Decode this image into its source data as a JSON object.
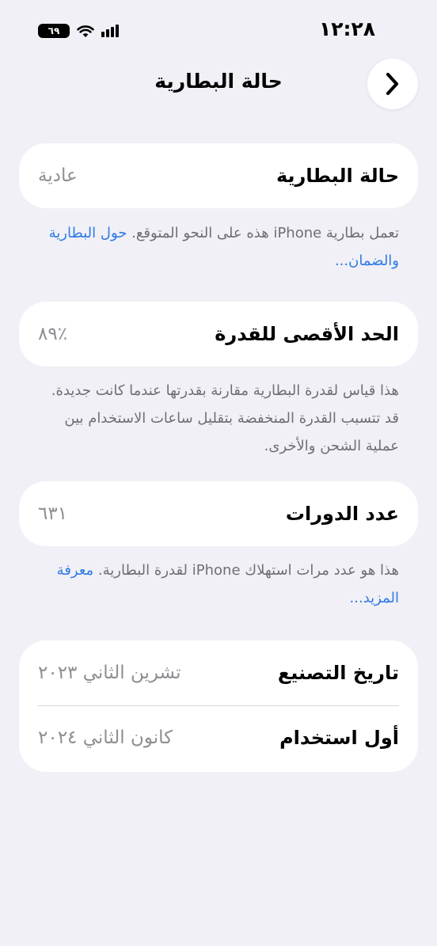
{
  "status_bar": {
    "time": "١٢:٢٨",
    "battery_level": "٦٩"
  },
  "nav": {
    "title": "حالة البطارية"
  },
  "battery_health": {
    "label": "حالة البطارية",
    "value": "عادية",
    "note": "تعمل بطارية iPhone هذه على النحو المتوقع.",
    "link": "حول البطارية والضمان..."
  },
  "max_capacity": {
    "label": "الحد الأقصى للقدرة",
    "value": "٪٨٩",
    "note": "هذا قياس لقدرة البطارية مقارنة بقدرتها عندما كانت جديدة. قد تتسبب القدرة المنخفضة بتقليل ساعات الاستخدام بين عملية الشحن والأخرى."
  },
  "cycle_count": {
    "label": "عدد الدورات",
    "value": "٦٣١",
    "note": "هذا هو عدد مرات استهلاك iPhone لقدرة البطارية.",
    "link": "معرفة المزيد..."
  },
  "dates": {
    "manufacture_label": "تاريخ التصنيع",
    "manufacture_value": "تشرين الثاني ٢٠٢٣",
    "first_use_label": "أول استخدام",
    "first_use_value": "كانون الثاني ٢٠٢٤"
  }
}
